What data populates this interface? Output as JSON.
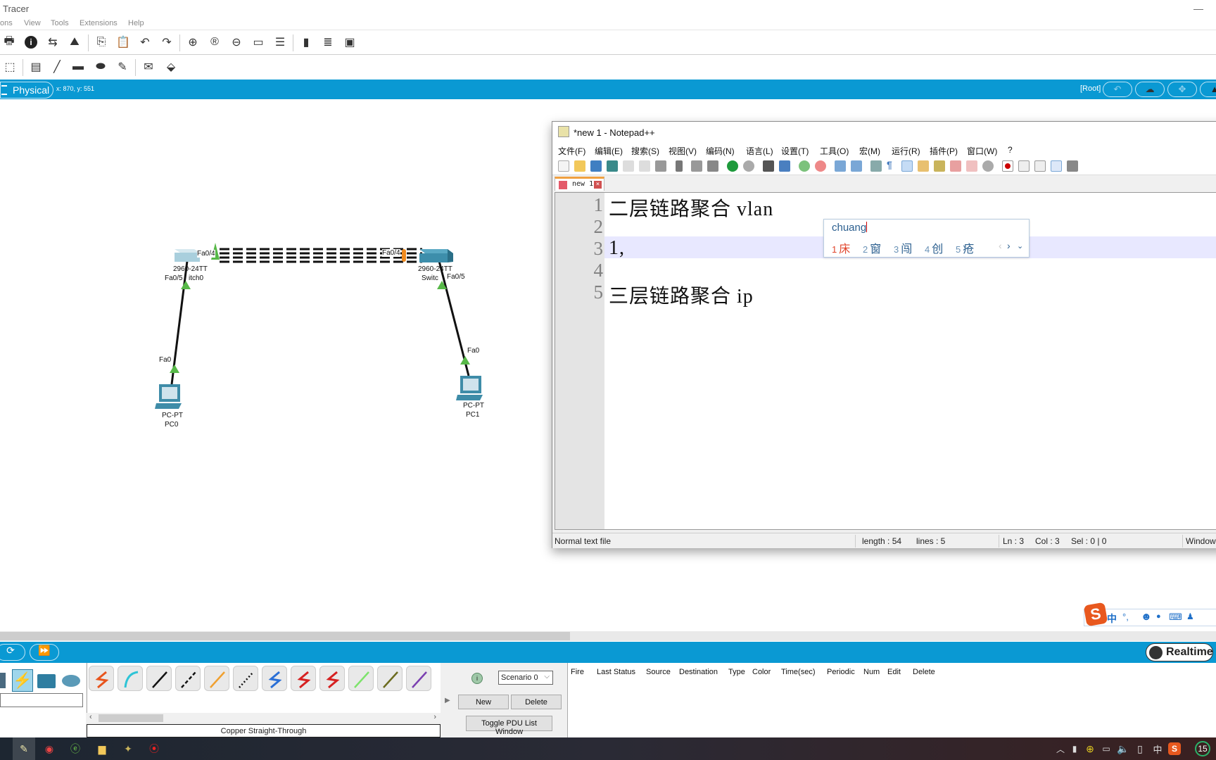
{
  "app": {
    "title": "Tracer"
  },
  "menu": [
    "ons",
    "View",
    "Tools",
    "Extensions",
    "Help"
  ],
  "toolbar1_icons": [
    "print-icon",
    "info-icon",
    "user-transfer-icon",
    "activity-wizard-icon",
    "copy-icon",
    "paste-icon",
    "undo-icon",
    "redo-icon",
    "zoom-in-icon",
    "zoom-reset-icon",
    "zoom-out-icon",
    "window-icon",
    "list-icon",
    "notes-icon",
    "device-rack-icon",
    "image-icon"
  ],
  "toolbar2_icons": [
    "select-icon",
    "note-icon",
    "line-icon",
    "rectangle-icon",
    "ellipse-icon",
    "freeform-icon",
    "simple-pdu-icon",
    "complex-pdu-icon"
  ],
  "workspace": {
    "mode": "Physical",
    "coords": "x: 870, y: 551",
    "root": "[Root]"
  },
  "topology": {
    "switch0": {
      "model": "2960-24TT",
      "name": "Switch0",
      "name_visible": "itch0",
      "port_up": "Fa0/4",
      "port_down": "Fa0/5"
    },
    "switch1": {
      "model": "2960-24TT",
      "name": "Switch1",
      "name_visible": "Switc",
      "port_up": "Fa0/4",
      "port_down": "Fa0/5"
    },
    "pc0": {
      "type": "PC-PT",
      "name": "PC0",
      "port": "Fa0"
    },
    "pc1": {
      "type": "PC-PT",
      "name": "PC1",
      "port": "Fa0"
    }
  },
  "notepad": {
    "title": "*new 1 - Notepad++",
    "menu": [
      "文件(F)",
      "编辑(E)",
      "搜索(S)",
      "视图(V)",
      "编码(N)",
      "语言(L)",
      "设置(T)",
      "工具(O)",
      "宏(M)",
      "运行(R)",
      "插件(P)",
      "窗口(W)",
      "?"
    ],
    "tab": "new 1",
    "lines": [
      {
        "n": "1",
        "text": "二层链路聚合 vlan"
      },
      {
        "n": "2",
        "text": ""
      },
      {
        "n": "3",
        "text": "1,"
      },
      {
        "n": "4",
        "text": ""
      },
      {
        "n": "5",
        "text": "三层链路聚合 ip"
      }
    ],
    "status": {
      "type": "Normal text file",
      "length": "length : 54",
      "lines": "lines : 5",
      "ln": "Ln : 3",
      "col": "Col : 3",
      "sel": "Sel : 0 | 0",
      "eol": "Window"
    }
  },
  "ime": {
    "input": "chuang",
    "candidates": [
      {
        "n": "1",
        "c": "床"
      },
      {
        "n": "2",
        "c": "窗"
      },
      {
        "n": "3",
        "c": "闯"
      },
      {
        "n": "4",
        "c": "创"
      },
      {
        "n": "5",
        "c": "疮"
      }
    ],
    "toolbar": [
      "中",
      "°,",
      "☻",
      "🎤",
      "⌨",
      "👥"
    ]
  },
  "simulation": {
    "realtime": "Realtime"
  },
  "cables": {
    "selected": "Copper Straight-Through",
    "items": [
      {
        "name": "automatic",
        "color": "#e8541c"
      },
      {
        "name": "console",
        "color": "#2ec4d6"
      },
      {
        "name": "copper-straight-through",
        "color": "#111111"
      },
      {
        "name": "copper-cross-over",
        "color": "#111111"
      },
      {
        "name": "fiber",
        "color": "#f0a030"
      },
      {
        "name": "phone",
        "color": "#111111"
      },
      {
        "name": "coaxial",
        "color": "#2a6fd6"
      },
      {
        "name": "serial-dce",
        "color": "#d62020"
      },
      {
        "name": "serial-dte",
        "color": "#d62020"
      },
      {
        "name": "octal",
        "color": "#7de36b"
      },
      {
        "name": "iot-custom",
        "color": "#6b6b1e"
      },
      {
        "name": "usb",
        "color": "#7a3fb0"
      }
    ]
  },
  "pdu": {
    "scenario": "Scenario 0",
    "new": "New",
    "delete": "Delete",
    "toggle": "Toggle PDU List Window",
    "columns": [
      "Fire",
      "Last Status",
      "Source",
      "Destination",
      "Type",
      "Color",
      "Time(sec)",
      "Periodic",
      "Num",
      "Edit",
      "Delete"
    ]
  },
  "taskbar": {
    "clock_badge": "15",
    "ime_lang": "中"
  }
}
